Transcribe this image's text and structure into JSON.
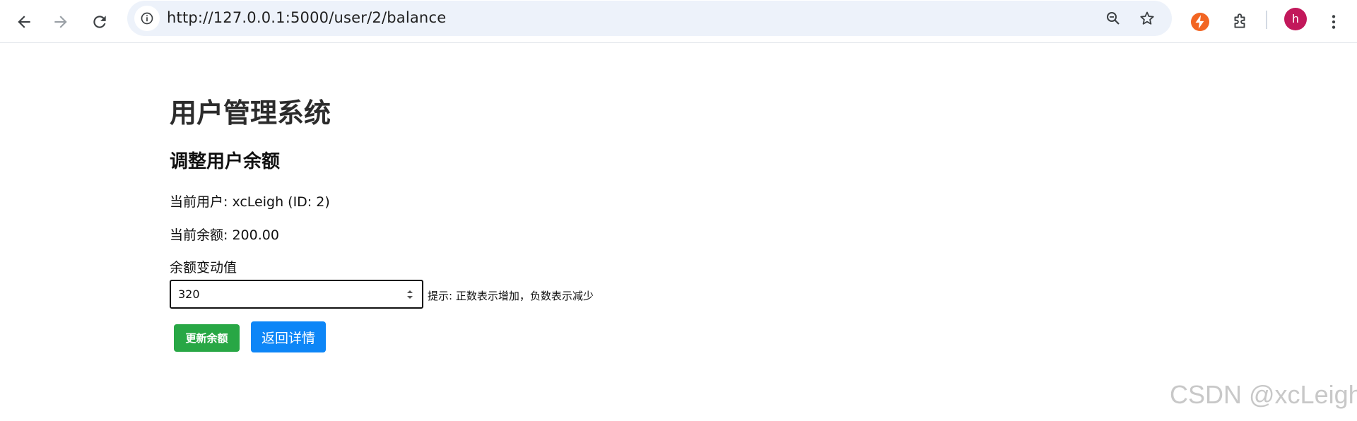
{
  "browser": {
    "url": "http://127.0.0.1:5000/user/2/balance",
    "avatar_initial": "h"
  },
  "page": {
    "app_title": "用户管理系统",
    "section_title": "调整用户余额",
    "current_user": "当前用户: xcLeigh (ID: 2)",
    "current_balance": "当前余额: 200.00",
    "field_label": "余额变动值",
    "input_value": "320",
    "hint": "提示: 正数表示增加，负数表示减少",
    "update_button": "更新余额",
    "back_button": "返回详情"
  },
  "watermark": "CSDN @xcLeigh",
  "colors": {
    "update_button": "#28a745",
    "back_button": "#0d86f7",
    "avatar": "#c2185b",
    "omnibox": "#edf2fa"
  }
}
